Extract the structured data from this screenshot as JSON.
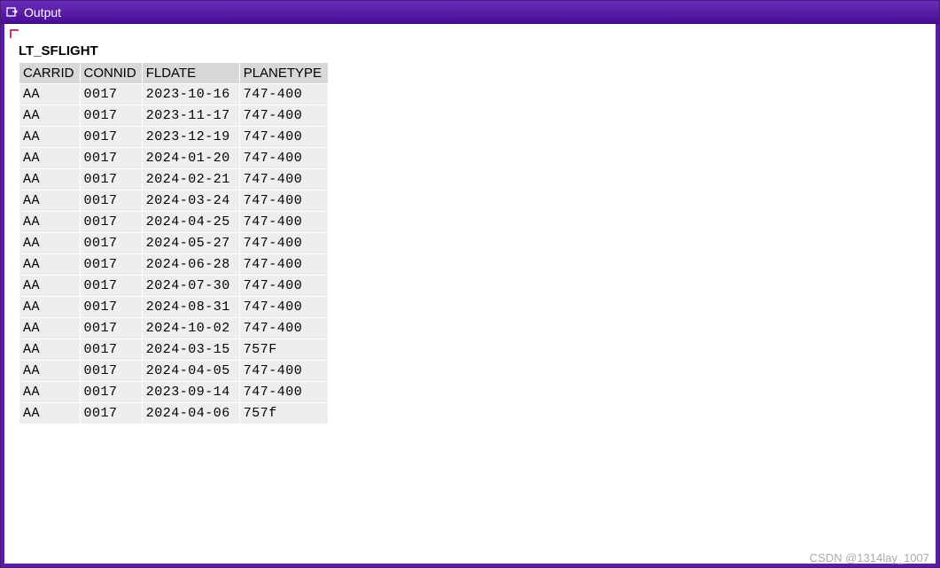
{
  "window": {
    "title": "Output"
  },
  "table": {
    "title": "LT_SFLIGHT",
    "columns": [
      "CARRID",
      "CONNID",
      "FLDATE",
      "PLANETYPE"
    ],
    "rows": [
      {
        "carrid": "AA",
        "connid": "0017",
        "fldate": "2023-10-16",
        "planetype": "747-400"
      },
      {
        "carrid": "AA",
        "connid": "0017",
        "fldate": "2023-11-17",
        "planetype": "747-400"
      },
      {
        "carrid": "AA",
        "connid": "0017",
        "fldate": "2023-12-19",
        "planetype": "747-400"
      },
      {
        "carrid": "AA",
        "connid": "0017",
        "fldate": "2024-01-20",
        "planetype": "747-400"
      },
      {
        "carrid": "AA",
        "connid": "0017",
        "fldate": "2024-02-21",
        "planetype": "747-400"
      },
      {
        "carrid": "AA",
        "connid": "0017",
        "fldate": "2024-03-24",
        "planetype": "747-400"
      },
      {
        "carrid": "AA",
        "connid": "0017",
        "fldate": "2024-04-25",
        "planetype": "747-400"
      },
      {
        "carrid": "AA",
        "connid": "0017",
        "fldate": "2024-05-27",
        "planetype": "747-400"
      },
      {
        "carrid": "AA",
        "connid": "0017",
        "fldate": "2024-06-28",
        "planetype": "747-400"
      },
      {
        "carrid": "AA",
        "connid": "0017",
        "fldate": "2024-07-30",
        "planetype": "747-400"
      },
      {
        "carrid": "AA",
        "connid": "0017",
        "fldate": "2024-08-31",
        "planetype": "747-400"
      },
      {
        "carrid": "AA",
        "connid": "0017",
        "fldate": "2024-10-02",
        "planetype": "747-400"
      },
      {
        "carrid": "AA",
        "connid": "0017",
        "fldate": "2024-03-15",
        "planetype": "757F"
      },
      {
        "carrid": "AA",
        "connid": "0017",
        "fldate": "2024-04-05",
        "planetype": "747-400"
      },
      {
        "carrid": "AA",
        "connid": "0017",
        "fldate": "2023-09-14",
        "planetype": "747-400"
      },
      {
        "carrid": "AA",
        "connid": "0017",
        "fldate": "2024-04-06",
        "planetype": "757f"
      }
    ]
  },
  "footer": {
    "credit": "CSDN @1314lay_1007"
  }
}
